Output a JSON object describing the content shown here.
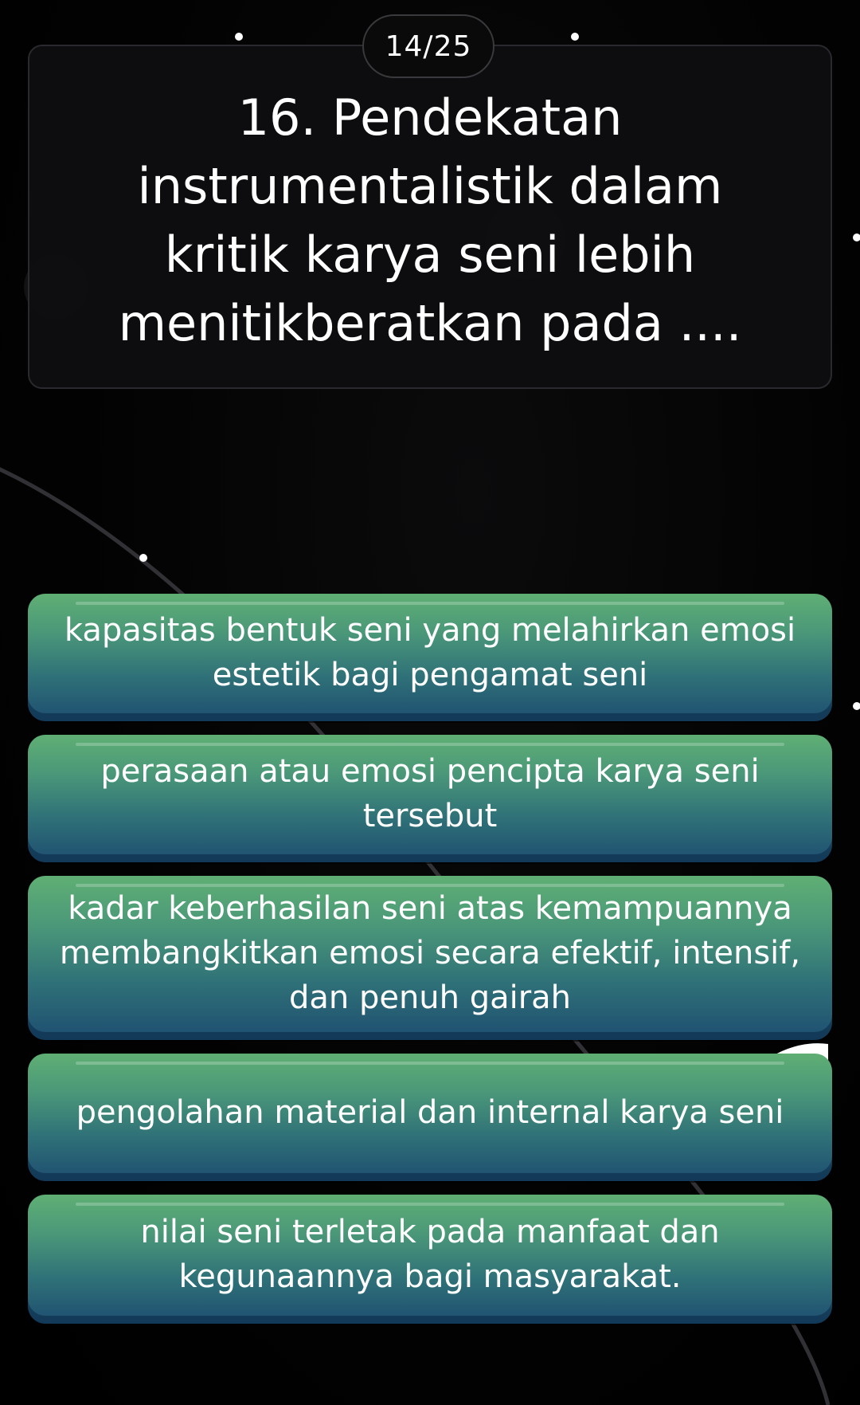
{
  "progress": {
    "counter_label": "14/25"
  },
  "question": {
    "text": "16. Pendekatan instrumentalistik dalam kritik karya seni lebih menitikberatkan pada ...."
  },
  "answers": [
    {
      "label": "kapasitas bentuk seni yang melahirkan emosi estetik bagi pengamat seni"
    },
    {
      "label": "perasaan atau emosi pencipta karya seni tersebut"
    },
    {
      "label": "kadar keberhasilan seni atas kemampuannya membangkitkan emosi secara efektif, intensif, dan penuh gairah"
    },
    {
      "label": "pengolahan material dan internal karya seni"
    },
    {
      "label": "nilai seni terletak pada manfaat dan kegunaannya bagi masyarakat."
    }
  ],
  "colors": {
    "background": "#000000",
    "answer_top": "#5faf74",
    "answer_bottom": "#1e4e70",
    "text": "#ffffff"
  }
}
